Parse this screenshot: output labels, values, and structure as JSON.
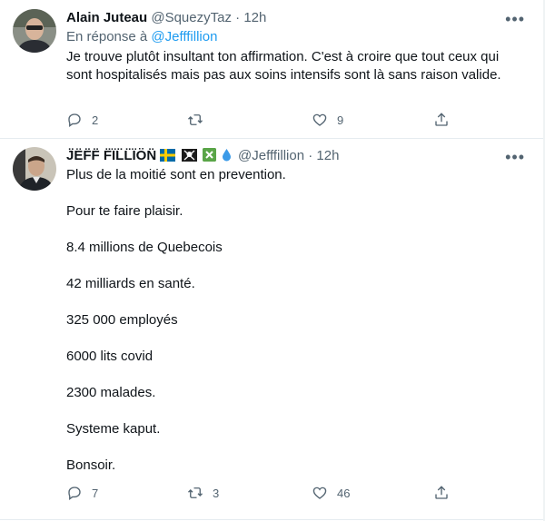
{
  "tweet1": {
    "name": "Alain Juteau",
    "handle": "@SquezyTaz",
    "dot": "·",
    "time": "12h",
    "more": "•••",
    "reply_prefix": "En réponse à",
    "reply_handle": "@Jefffillion",
    "text": "Je trouve plutôt insultant ton affirmation. C'est à croire que tout ceux qui sont hospitalisés mais pas aux soins intensifs sont là sans raison valide.",
    "reply_count": "2",
    "retweet_count": "",
    "like_count": "9"
  },
  "tweet2": {
    "name": "J̈ËF̈F̈ F̈ÏL̈L̈ÏÖN̈",
    "handle": "@Jefffillion",
    "dot": "·",
    "time": "12h",
    "more": "•••",
    "lines": [
      "Plus de la moitié sont en prevention.",
      "Pour te faire plaisir.",
      "8.4 millions de Quebecois",
      "42 milliards en santé.",
      "325 000 employés",
      "6000 lits covid",
      "2300 malades.",
      "Systeme kaput.",
      "Bonsoir."
    ],
    "reply_count": "7",
    "retweet_count": "3",
    "like_count": "46"
  },
  "colors": {
    "link": "#1d9bf0",
    "muted": "#536471",
    "text": "#0f1419"
  }
}
